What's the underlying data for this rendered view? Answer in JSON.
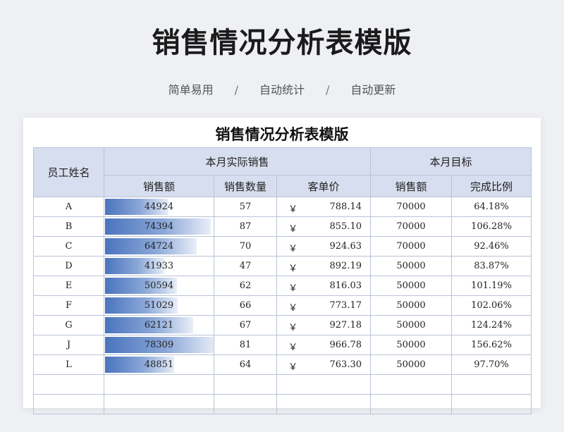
{
  "header": {
    "title": "销售情况分析表模版",
    "tags": [
      "简单易用",
      "自动统计",
      "自动更新"
    ],
    "separator": "/"
  },
  "sheet": {
    "title": "销售情况分析表模版",
    "columns": {
      "name": "员工姓名",
      "actual_group": "本月实际销售",
      "target_group": "本月目标",
      "sales": "销售额",
      "qty": "销售数量",
      "unit_price": "客单价",
      "target_sales": "销售额",
      "completion": "完成比例"
    },
    "currency_symbol": "￥",
    "bar_colors": {
      "start": "#4a74bd",
      "end": "#e9eef8"
    },
    "bar_max": 100000,
    "rows": [
      {
        "name": "A",
        "sales": "44924",
        "sales_value": 44924,
        "qty": "57",
        "price": "788.14",
        "target": "70000",
        "completion": "64.18%"
      },
      {
        "name": "B",
        "sales": "74394",
        "sales_value": 74394,
        "qty": "87",
        "price": "855.10",
        "target": "70000",
        "completion": "106.28%"
      },
      {
        "name": "C",
        "sales": "64724",
        "sales_value": 64724,
        "qty": "70",
        "price": "924.63",
        "target": "70000",
        "completion": "92.46%"
      },
      {
        "name": "D",
        "sales": "41933",
        "sales_value": 41933,
        "qty": "47",
        "price": "892.19",
        "target": "50000",
        "completion": "83.87%"
      },
      {
        "name": "E",
        "sales": "50594",
        "sales_value": 50594,
        "qty": "62",
        "price": "816.03",
        "target": "50000",
        "completion": "101.19%"
      },
      {
        "name": "F",
        "sales": "51029",
        "sales_value": 51029,
        "qty": "66",
        "price": "773.17",
        "target": "50000",
        "completion": "102.06%"
      },
      {
        "name": "G",
        "sales": "62121",
        "sales_value": 62121,
        "qty": "67",
        "price": "927.18",
        "target": "50000",
        "completion": "124.24%"
      },
      {
        "name": "J",
        "sales": "78309",
        "sales_value": 78309,
        "qty": "81",
        "price": "966.78",
        "target": "50000",
        "completion": "156.62%"
      },
      {
        "name": "L",
        "sales": "48851",
        "sales_value": 48851,
        "qty": "64",
        "price": "763.30",
        "target": "50000",
        "completion": "97.70%"
      }
    ]
  }
}
